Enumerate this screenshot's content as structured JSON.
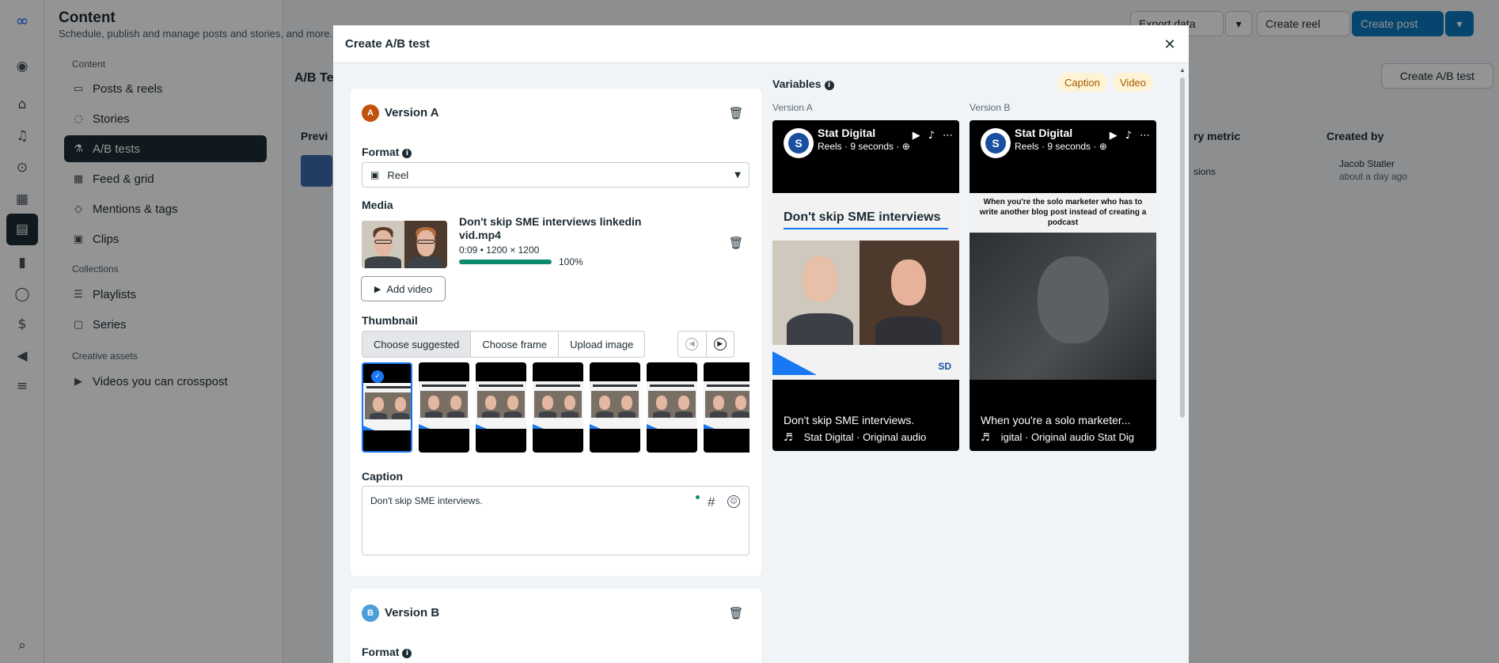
{
  "app": {
    "title": "Content",
    "subtitle": "Schedule, publish and manage posts and stories, and more.",
    "top_buttons": {
      "export": "Export data",
      "create_reel": "Create reel",
      "create_post": "Create post",
      "create_ab": "Create A/B test"
    },
    "page_heading": "A/B Te",
    "col_preview": "Previ",
    "col_metric": "ry metric",
    "col_created_by": "Created by",
    "row_metric": "sions",
    "row_created_by": "Jacob Statler",
    "row_created_when": "about a day ago"
  },
  "sidebar": {
    "section_content": "Content",
    "items_content": [
      {
        "label": "Posts & reels",
        "icon": "posts-icon"
      },
      {
        "label": "Stories",
        "icon": "stories-icon"
      },
      {
        "label": "A/B tests",
        "icon": "flask-icon"
      },
      {
        "label": "Feed & grid",
        "icon": "grid-icon"
      },
      {
        "label": "Mentions & tags",
        "icon": "tag-icon"
      },
      {
        "label": "Clips",
        "icon": "clips-icon"
      }
    ],
    "section_collections": "Collections",
    "items_collections": [
      {
        "label": "Playlists",
        "icon": "playlist-icon"
      },
      {
        "label": "Series",
        "icon": "series-icon"
      }
    ],
    "section_creative": "Creative assets",
    "items_creative": [
      {
        "label": "Videos you can crosspost",
        "icon": "video-icon"
      }
    ]
  },
  "modal": {
    "title": "Create A/B test",
    "version_a": {
      "badge": "A",
      "title": "Version A",
      "format_label": "Format",
      "format_value": "Reel",
      "media_label": "Media",
      "file_name": "Don't skip SME interviews linkedin vid.mp4",
      "file_meta": "0:09 • 1200 × 1200",
      "upload_progress": 100,
      "upload_pct": "100%",
      "add_video": "Add video",
      "thumbnail_label": "Thumbnail",
      "thumb_tabs": [
        "Choose suggested",
        "Choose frame",
        "Upload image"
      ],
      "caption_label": "Caption",
      "caption_value": "Don't skip SME interviews."
    },
    "version_b": {
      "badge": "B",
      "title": "Version B",
      "format_label": "Format"
    },
    "variables": {
      "title": "Variables",
      "pills": [
        "Caption",
        "Video"
      ],
      "preview_a_label": "Version A",
      "preview_b_label": "Version B",
      "page_name": "Stat Digital",
      "page_meta": "Reels · 9 seconds · ",
      "headline_a": "Don't skip SME interviews",
      "caption_overlay_b": "When you're the solo marketer who has to write another blog post instead of creating a podcast",
      "preview_a_caption": "Don't skip SME interviews.",
      "preview_b_caption": "When you're a solo marketer...",
      "audio_a": "Stat Digital · Original audio",
      "audio_b": "igital · Original audio     Stat Dig"
    }
  },
  "colors": {
    "accent": "#1877f2",
    "badge_a": "#c2510e",
    "badge_b": "#4a9fd8",
    "progress": "#0d8b6d"
  }
}
